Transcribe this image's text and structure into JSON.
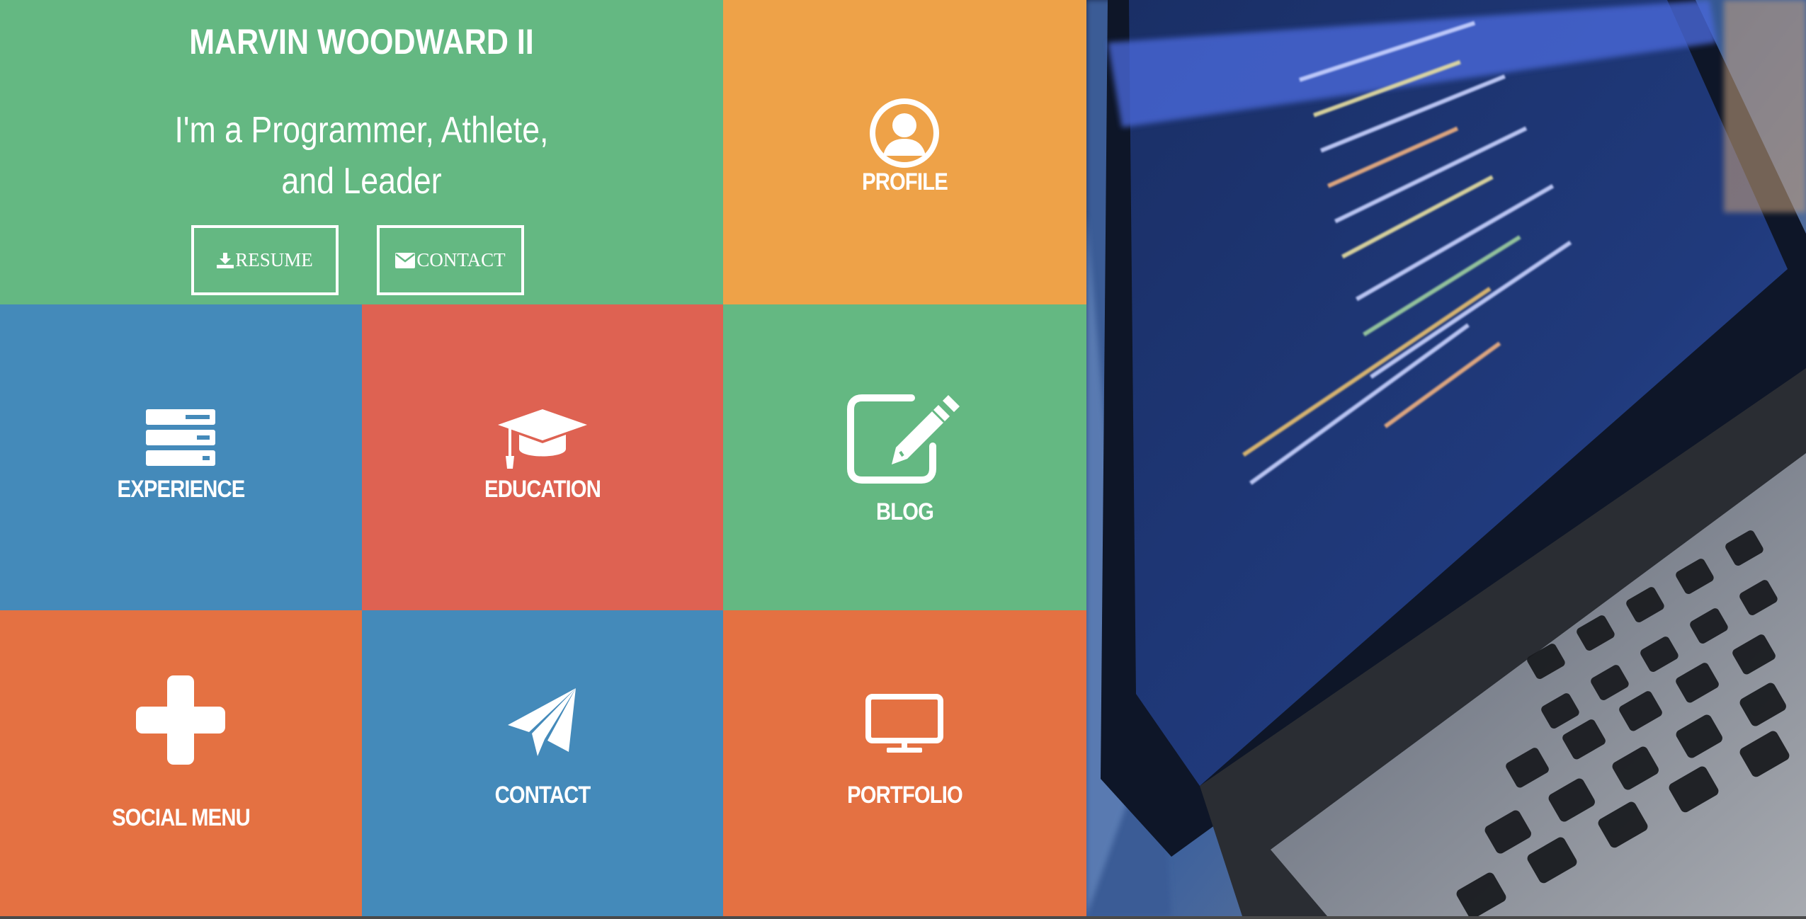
{
  "hero": {
    "name": "MARVIN WOODWARD II",
    "tagline_line1": "I'm a Programmer, Athlete,",
    "tagline_line2": "and Leader",
    "resume_label": "RESUME",
    "contact_label": "CONTACT",
    "color": "#64b882"
  },
  "tiles": {
    "profile": {
      "label": "PROFILE",
      "icon": "user-circle-icon",
      "color": "#eea248"
    },
    "experience": {
      "label": "EXPERIENCE",
      "icon": "server-stack-icon",
      "color": "#448aba"
    },
    "education": {
      "label": "EDUCATION",
      "icon": "graduation-cap-icon",
      "color": "#de6252"
    },
    "blog": {
      "label": "BLOG",
      "icon": "edit-square-icon",
      "color": "#64b882"
    },
    "social": {
      "label": "SOCIAL MENU",
      "icon": "plus-icon",
      "color": "#e47142"
    },
    "contact": {
      "label": "CONTACT",
      "icon": "paper-plane-icon",
      "color": "#448aba"
    },
    "portfolio": {
      "label": "PORTFOLIO",
      "icon": "monitor-icon",
      "color": "#e47142"
    }
  },
  "photo": {
    "subject": "laptop with code on screen"
  }
}
